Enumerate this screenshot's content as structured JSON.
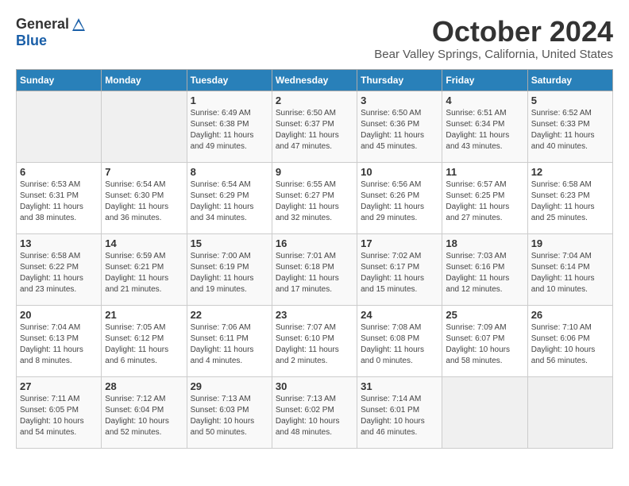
{
  "header": {
    "logo_general": "General",
    "logo_blue": "Blue",
    "month_title": "October 2024",
    "location": "Bear Valley Springs, California, United States"
  },
  "weekdays": [
    "Sunday",
    "Monday",
    "Tuesday",
    "Wednesday",
    "Thursday",
    "Friday",
    "Saturday"
  ],
  "weeks": [
    [
      {
        "day": "",
        "info": ""
      },
      {
        "day": "",
        "info": ""
      },
      {
        "day": "1",
        "info": "Sunrise: 6:49 AM\nSunset: 6:38 PM\nDaylight: 11 hours and 49 minutes."
      },
      {
        "day": "2",
        "info": "Sunrise: 6:50 AM\nSunset: 6:37 PM\nDaylight: 11 hours and 47 minutes."
      },
      {
        "day": "3",
        "info": "Sunrise: 6:50 AM\nSunset: 6:36 PM\nDaylight: 11 hours and 45 minutes."
      },
      {
        "day": "4",
        "info": "Sunrise: 6:51 AM\nSunset: 6:34 PM\nDaylight: 11 hours and 43 minutes."
      },
      {
        "day": "5",
        "info": "Sunrise: 6:52 AM\nSunset: 6:33 PM\nDaylight: 11 hours and 40 minutes."
      }
    ],
    [
      {
        "day": "6",
        "info": "Sunrise: 6:53 AM\nSunset: 6:31 PM\nDaylight: 11 hours and 38 minutes."
      },
      {
        "day": "7",
        "info": "Sunrise: 6:54 AM\nSunset: 6:30 PM\nDaylight: 11 hours and 36 minutes."
      },
      {
        "day": "8",
        "info": "Sunrise: 6:54 AM\nSunset: 6:29 PM\nDaylight: 11 hours and 34 minutes."
      },
      {
        "day": "9",
        "info": "Sunrise: 6:55 AM\nSunset: 6:27 PM\nDaylight: 11 hours and 32 minutes."
      },
      {
        "day": "10",
        "info": "Sunrise: 6:56 AM\nSunset: 6:26 PM\nDaylight: 11 hours and 29 minutes."
      },
      {
        "day": "11",
        "info": "Sunrise: 6:57 AM\nSunset: 6:25 PM\nDaylight: 11 hours and 27 minutes."
      },
      {
        "day": "12",
        "info": "Sunrise: 6:58 AM\nSunset: 6:23 PM\nDaylight: 11 hours and 25 minutes."
      }
    ],
    [
      {
        "day": "13",
        "info": "Sunrise: 6:58 AM\nSunset: 6:22 PM\nDaylight: 11 hours and 23 minutes."
      },
      {
        "day": "14",
        "info": "Sunrise: 6:59 AM\nSunset: 6:21 PM\nDaylight: 11 hours and 21 minutes."
      },
      {
        "day": "15",
        "info": "Sunrise: 7:00 AM\nSunset: 6:19 PM\nDaylight: 11 hours and 19 minutes."
      },
      {
        "day": "16",
        "info": "Sunrise: 7:01 AM\nSunset: 6:18 PM\nDaylight: 11 hours and 17 minutes."
      },
      {
        "day": "17",
        "info": "Sunrise: 7:02 AM\nSunset: 6:17 PM\nDaylight: 11 hours and 15 minutes."
      },
      {
        "day": "18",
        "info": "Sunrise: 7:03 AM\nSunset: 6:16 PM\nDaylight: 11 hours and 12 minutes."
      },
      {
        "day": "19",
        "info": "Sunrise: 7:04 AM\nSunset: 6:14 PM\nDaylight: 11 hours and 10 minutes."
      }
    ],
    [
      {
        "day": "20",
        "info": "Sunrise: 7:04 AM\nSunset: 6:13 PM\nDaylight: 11 hours and 8 minutes."
      },
      {
        "day": "21",
        "info": "Sunrise: 7:05 AM\nSunset: 6:12 PM\nDaylight: 11 hours and 6 minutes."
      },
      {
        "day": "22",
        "info": "Sunrise: 7:06 AM\nSunset: 6:11 PM\nDaylight: 11 hours and 4 minutes."
      },
      {
        "day": "23",
        "info": "Sunrise: 7:07 AM\nSunset: 6:10 PM\nDaylight: 11 hours and 2 minutes."
      },
      {
        "day": "24",
        "info": "Sunrise: 7:08 AM\nSunset: 6:08 PM\nDaylight: 11 hours and 0 minutes."
      },
      {
        "day": "25",
        "info": "Sunrise: 7:09 AM\nSunset: 6:07 PM\nDaylight: 10 hours and 58 minutes."
      },
      {
        "day": "26",
        "info": "Sunrise: 7:10 AM\nSunset: 6:06 PM\nDaylight: 10 hours and 56 minutes."
      }
    ],
    [
      {
        "day": "27",
        "info": "Sunrise: 7:11 AM\nSunset: 6:05 PM\nDaylight: 10 hours and 54 minutes."
      },
      {
        "day": "28",
        "info": "Sunrise: 7:12 AM\nSunset: 6:04 PM\nDaylight: 10 hours and 52 minutes."
      },
      {
        "day": "29",
        "info": "Sunrise: 7:13 AM\nSunset: 6:03 PM\nDaylight: 10 hours and 50 minutes."
      },
      {
        "day": "30",
        "info": "Sunrise: 7:13 AM\nSunset: 6:02 PM\nDaylight: 10 hours and 48 minutes."
      },
      {
        "day": "31",
        "info": "Sunrise: 7:14 AM\nSunset: 6:01 PM\nDaylight: 10 hours and 46 minutes."
      },
      {
        "day": "",
        "info": ""
      },
      {
        "day": "",
        "info": ""
      }
    ]
  ]
}
